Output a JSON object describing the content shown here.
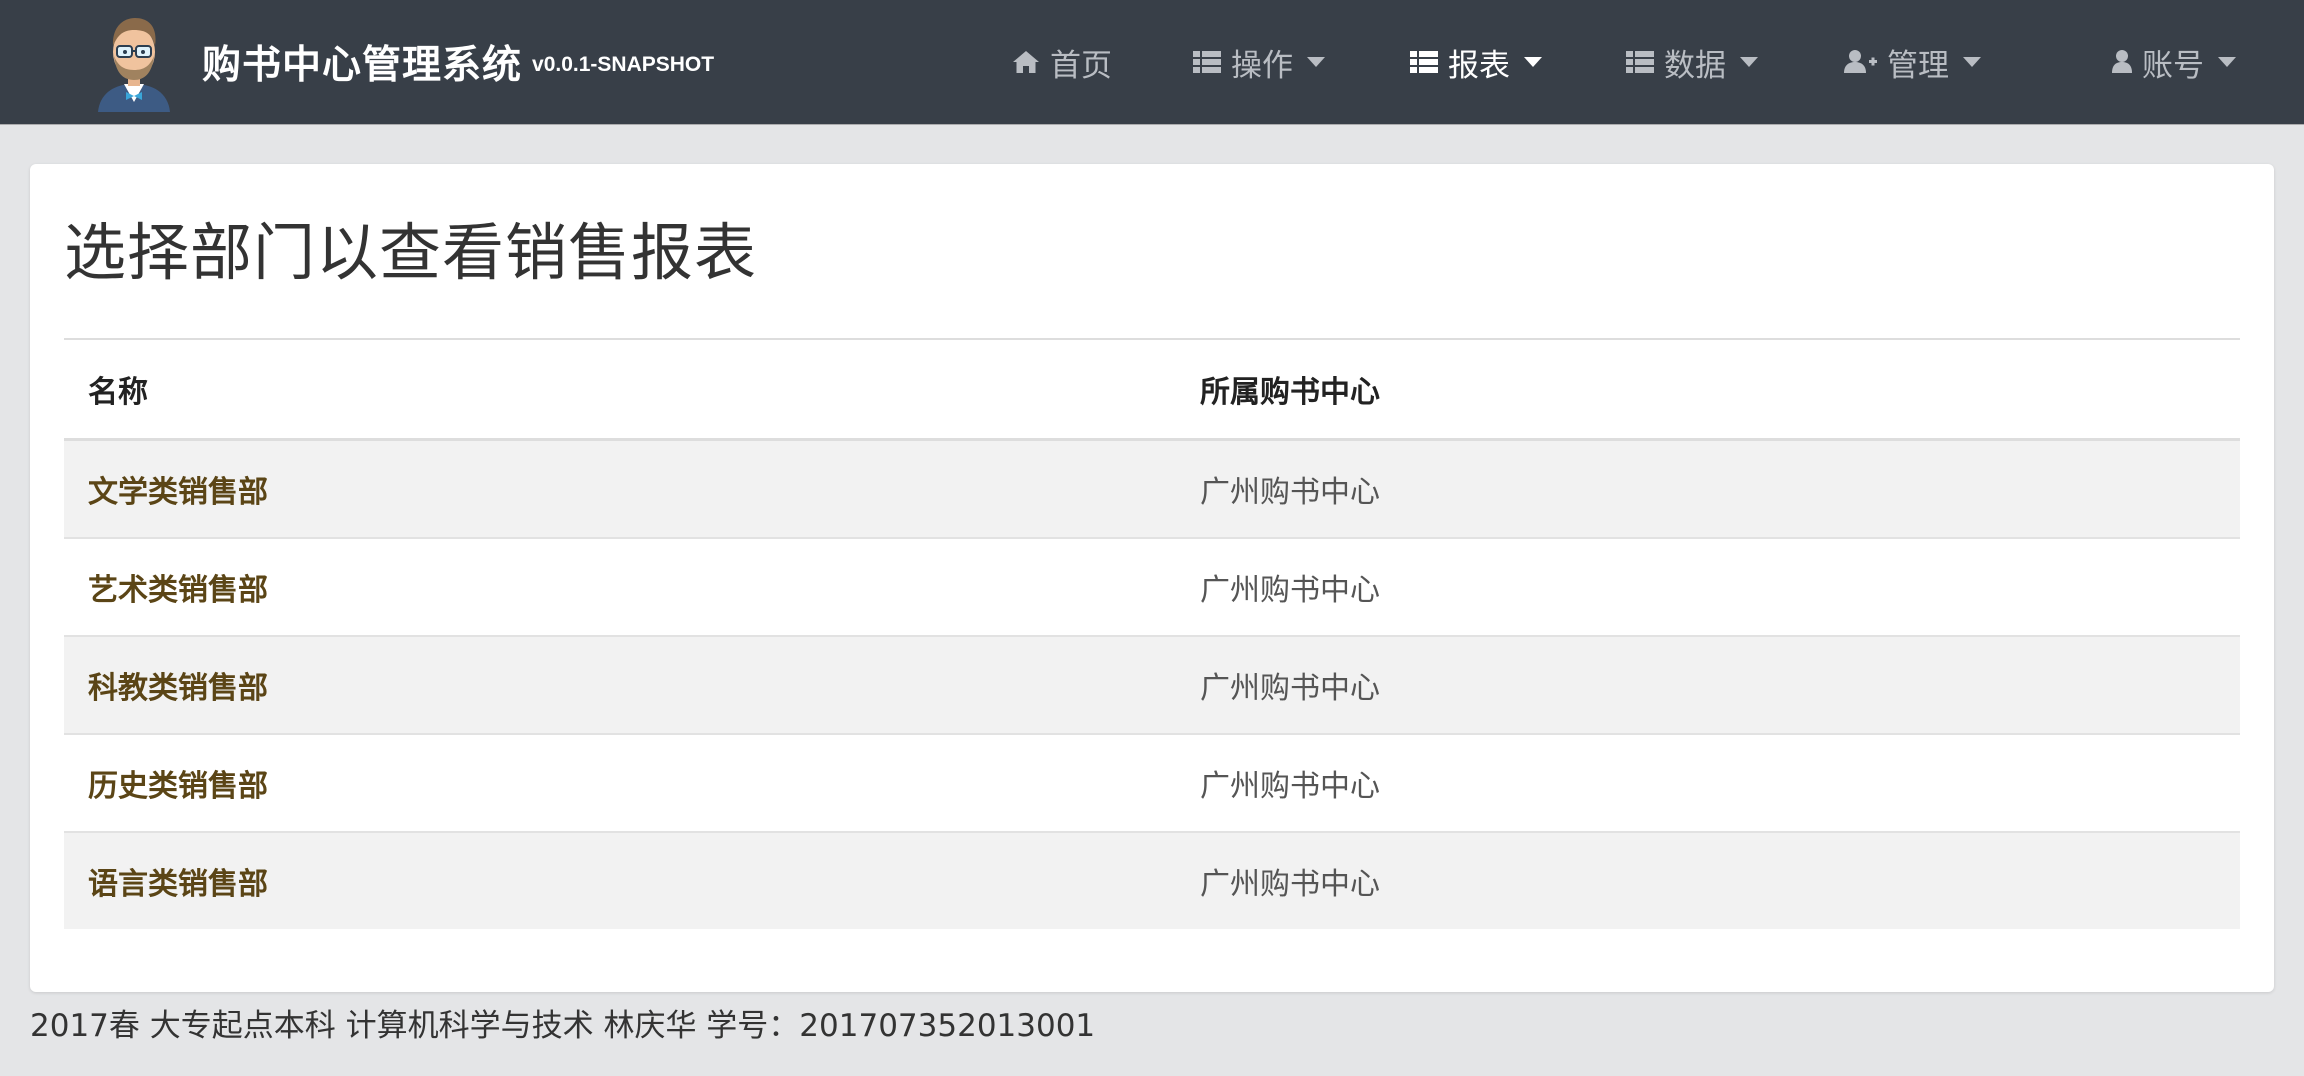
{
  "navbar": {
    "title": "购书中心管理系统",
    "version": "v0.0.1-SNAPSHOT",
    "items": [
      {
        "label": "首页",
        "icon": "home-icon",
        "dropdown": false,
        "active": false
      },
      {
        "label": "操作",
        "icon": "list-icon",
        "dropdown": true,
        "active": false
      },
      {
        "label": "报表",
        "icon": "list-icon",
        "dropdown": true,
        "active": true
      },
      {
        "label": "数据",
        "icon": "list-icon",
        "dropdown": true,
        "active": false
      },
      {
        "label": "管理",
        "icon": "user-plus-icon",
        "dropdown": true,
        "active": false
      },
      {
        "label": "账号",
        "icon": "user-icon",
        "dropdown": true,
        "active": false
      }
    ]
  },
  "main": {
    "title": "选择部门以查看销售报表",
    "table": {
      "headers": [
        "名称",
        "所属购书中心"
      ],
      "rows": [
        {
          "name": "文学类销售部",
          "center": "广州购书中心"
        },
        {
          "name": "艺术类销售部",
          "center": "广州购书中心"
        },
        {
          "name": "科教类销售部",
          "center": "广州购书中心"
        },
        {
          "name": "历史类销售部",
          "center": "广州购书中心"
        },
        {
          "name": "语言类销售部",
          "center": "广州购书中心"
        }
      ]
    }
  },
  "footer": {
    "text": "2017春 大专起点本科 计算机科学与技术 林庆华 学号：201707352013001"
  },
  "colors": {
    "navbar_bg": "#383f48",
    "nav_text": "#b9bdc3",
    "nav_active": "#ffffff",
    "page_bg": "#e4e5e7",
    "link": "#5b4516",
    "stripe": "#f2f2f2"
  }
}
